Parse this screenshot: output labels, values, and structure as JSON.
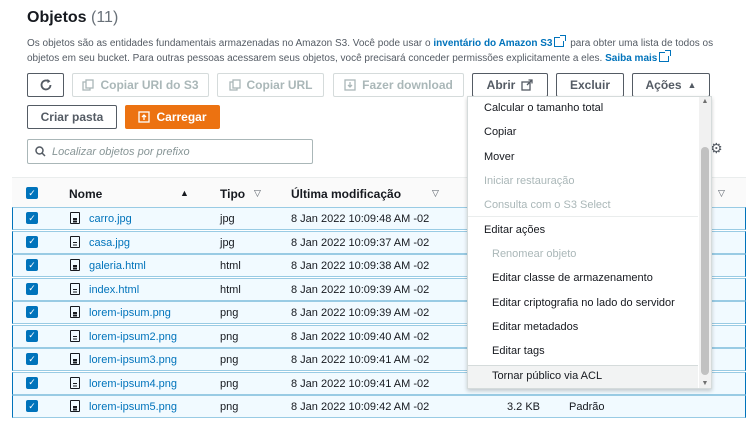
{
  "header": {
    "title": "Objetos",
    "count": "(11)"
  },
  "description": {
    "part1": "Os objetos são as entidades fundamentais armazenadas no Amazon S3. Você pode usar o",
    "link1": "inventário do Amazon S3",
    "part2": "para obter uma lista de todos os objetos",
    "part3": "em seu bucket. Para outras pessoas acessarem seus objetos, você precisará conceder permissões explicitamente a eles.",
    "link2": "Saiba mais"
  },
  "toolbar": {
    "refresh_icon": "refresh-icon",
    "copy_uri": "Copiar URI do S3",
    "copy_url": "Copiar URL",
    "download": "Fazer download",
    "open": "Abrir",
    "delete": "Excluir",
    "actions": "Ações",
    "create_folder": "Criar pasta",
    "upload": "Carregar"
  },
  "search": {
    "placeholder": "Localizar objetos por prefixo"
  },
  "table": {
    "columns": {
      "name": "Nome",
      "type": "Tipo",
      "modified": "Última modificação"
    },
    "rows": [
      {
        "name": "carro.jpg",
        "type": "jpg",
        "modified": "8 Jan 2022 10:09:48 AM -02"
      },
      {
        "name": "casa.jpg",
        "type": "jpg",
        "modified": "8 Jan 2022 10:09:37 AM -02"
      },
      {
        "name": "galeria.html",
        "type": "html",
        "modified": "8 Jan 2022 10:09:38 AM -02"
      },
      {
        "name": "index.html",
        "type": "html",
        "modified": "8 Jan 2022 10:09:39 AM -02"
      },
      {
        "name": "lorem-ipsum.png",
        "type": "png",
        "modified": "8 Jan 2022 10:09:39 AM -02"
      },
      {
        "name": "lorem-ipsum2.png",
        "type": "png",
        "modified": "8 Jan 2022 10:09:40 AM -02"
      },
      {
        "name": "lorem-ipsum3.png",
        "type": "png",
        "modified": "8 Jan 2022 10:09:41 AM -02"
      },
      {
        "name": "lorem-ipsum4.png",
        "type": "png",
        "modified": "8 Jan 2022 10:09:41 AM -02"
      },
      {
        "name": "lorem-ipsum5.png",
        "type": "png",
        "modified": "8 Jan 2022 10:09:42 AM -02",
        "size": "3.2 KB",
        "storage": "Padrão"
      }
    ]
  },
  "actions_menu": {
    "items": [
      "Calcular o tamanho total",
      "Copiar",
      "Mover",
      "Iniciar restauração",
      "Consulta com o S3 Select",
      "Editar ações",
      "Renomear objeto",
      "Editar classe de armazenamento",
      "Editar criptografia no lado do servidor",
      "Editar metadados",
      "Editar tags",
      "Tornar público via ACL"
    ]
  },
  "colors": {
    "accent": "#0073bb",
    "primary_button": "#ec7211",
    "selected_row": "#f1faff"
  }
}
